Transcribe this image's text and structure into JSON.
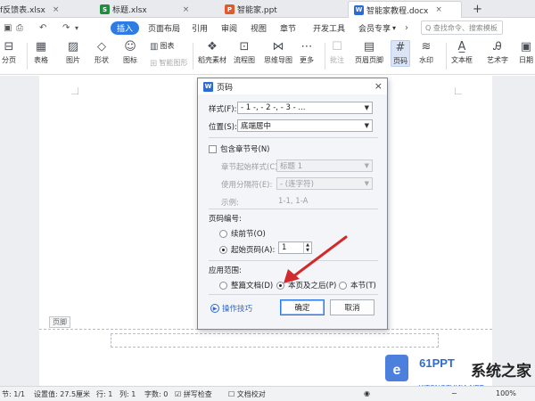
{
  "tabs": [
    {
      "label": "f反馈表.xlsx",
      "icon": "xlsx-icon",
      "color": "#1e8e3e"
    },
    {
      "label": "标题.xlsx",
      "icon": "xlsx-icon",
      "color": "#1e8e3e"
    },
    {
      "label": "智能家.ppt",
      "icon": "ppt-icon",
      "color": "#e05a2b"
    },
    {
      "label": "智能家教程.docx",
      "icon": "docx-icon",
      "color": "#2d6ad6",
      "active": true
    }
  ],
  "ribbon": {
    "insert": "插入",
    "page_layout": "页面布局",
    "references": "引用",
    "review": "审阅",
    "view": "视图",
    "chapter": "章节",
    "dev_tools": "开发工具",
    "member": "会员专享",
    "search_placeholder": "Q 查找命令、搜索模板"
  },
  "toolbar": {
    "page_break": "分页",
    "table": "表格",
    "image": "图片",
    "shape": "形状",
    "icon": "图标",
    "chart": "图表",
    "smart_graphic": "智能图形",
    "stock_material": "稻壳素材",
    "flowchart": "流程图",
    "mindmap": "思维导图",
    "more": "更多",
    "comment": "批注",
    "header_footer": "页眉页脚",
    "page_number": "页码",
    "watermark": "水印",
    "textbox": "文本框",
    "wordart": "艺术字",
    "date": "日期"
  },
  "dialog": {
    "title": "页码",
    "style_label": "样式(F):",
    "style_value": "- 1 -, - 2 -, - 3 - ...",
    "position_label": "位置(S):",
    "position_value": "底端居中",
    "include_chapter": "包含章节号(N)",
    "chapter_style_label": "章节起始样式(C):",
    "chapter_style_value": "标题 1",
    "separator_label": "使用分隔符(E):",
    "separator_value": "-   (连字符)",
    "example_label": "示例:",
    "example_value": "1-1, 1-A",
    "numbering_section": "页码编号:",
    "continue_prev": "续前节(O)",
    "start_at": "起始页码(A):",
    "start_value": "1",
    "apply_section": "应用范围:",
    "whole_doc": "整篇文档(D)",
    "this_and_after": "本页及之后(P)",
    "this_section": "本节(T)",
    "tips": "操作技巧",
    "ok": "确定",
    "cancel": "取消"
  },
  "document": {
    "footer_label": "页脚"
  },
  "statusbar": {
    "section": "节: 1/1",
    "setting": "设置值: 27.5厘米",
    "row": "行: 1",
    "col": "列: 1",
    "word_count": "字数: 0",
    "spell_check": "拼写检查",
    "doc_proof": "文档校对",
    "zoom": "100%"
  },
  "watermark": {
    "brand": "61PPT",
    "url": "XITONGZHIJIA.NET",
    "cn_text": "系统之家"
  },
  "colors": {
    "accent": "#2d7be5",
    "arrow": "#d3292a"
  }
}
